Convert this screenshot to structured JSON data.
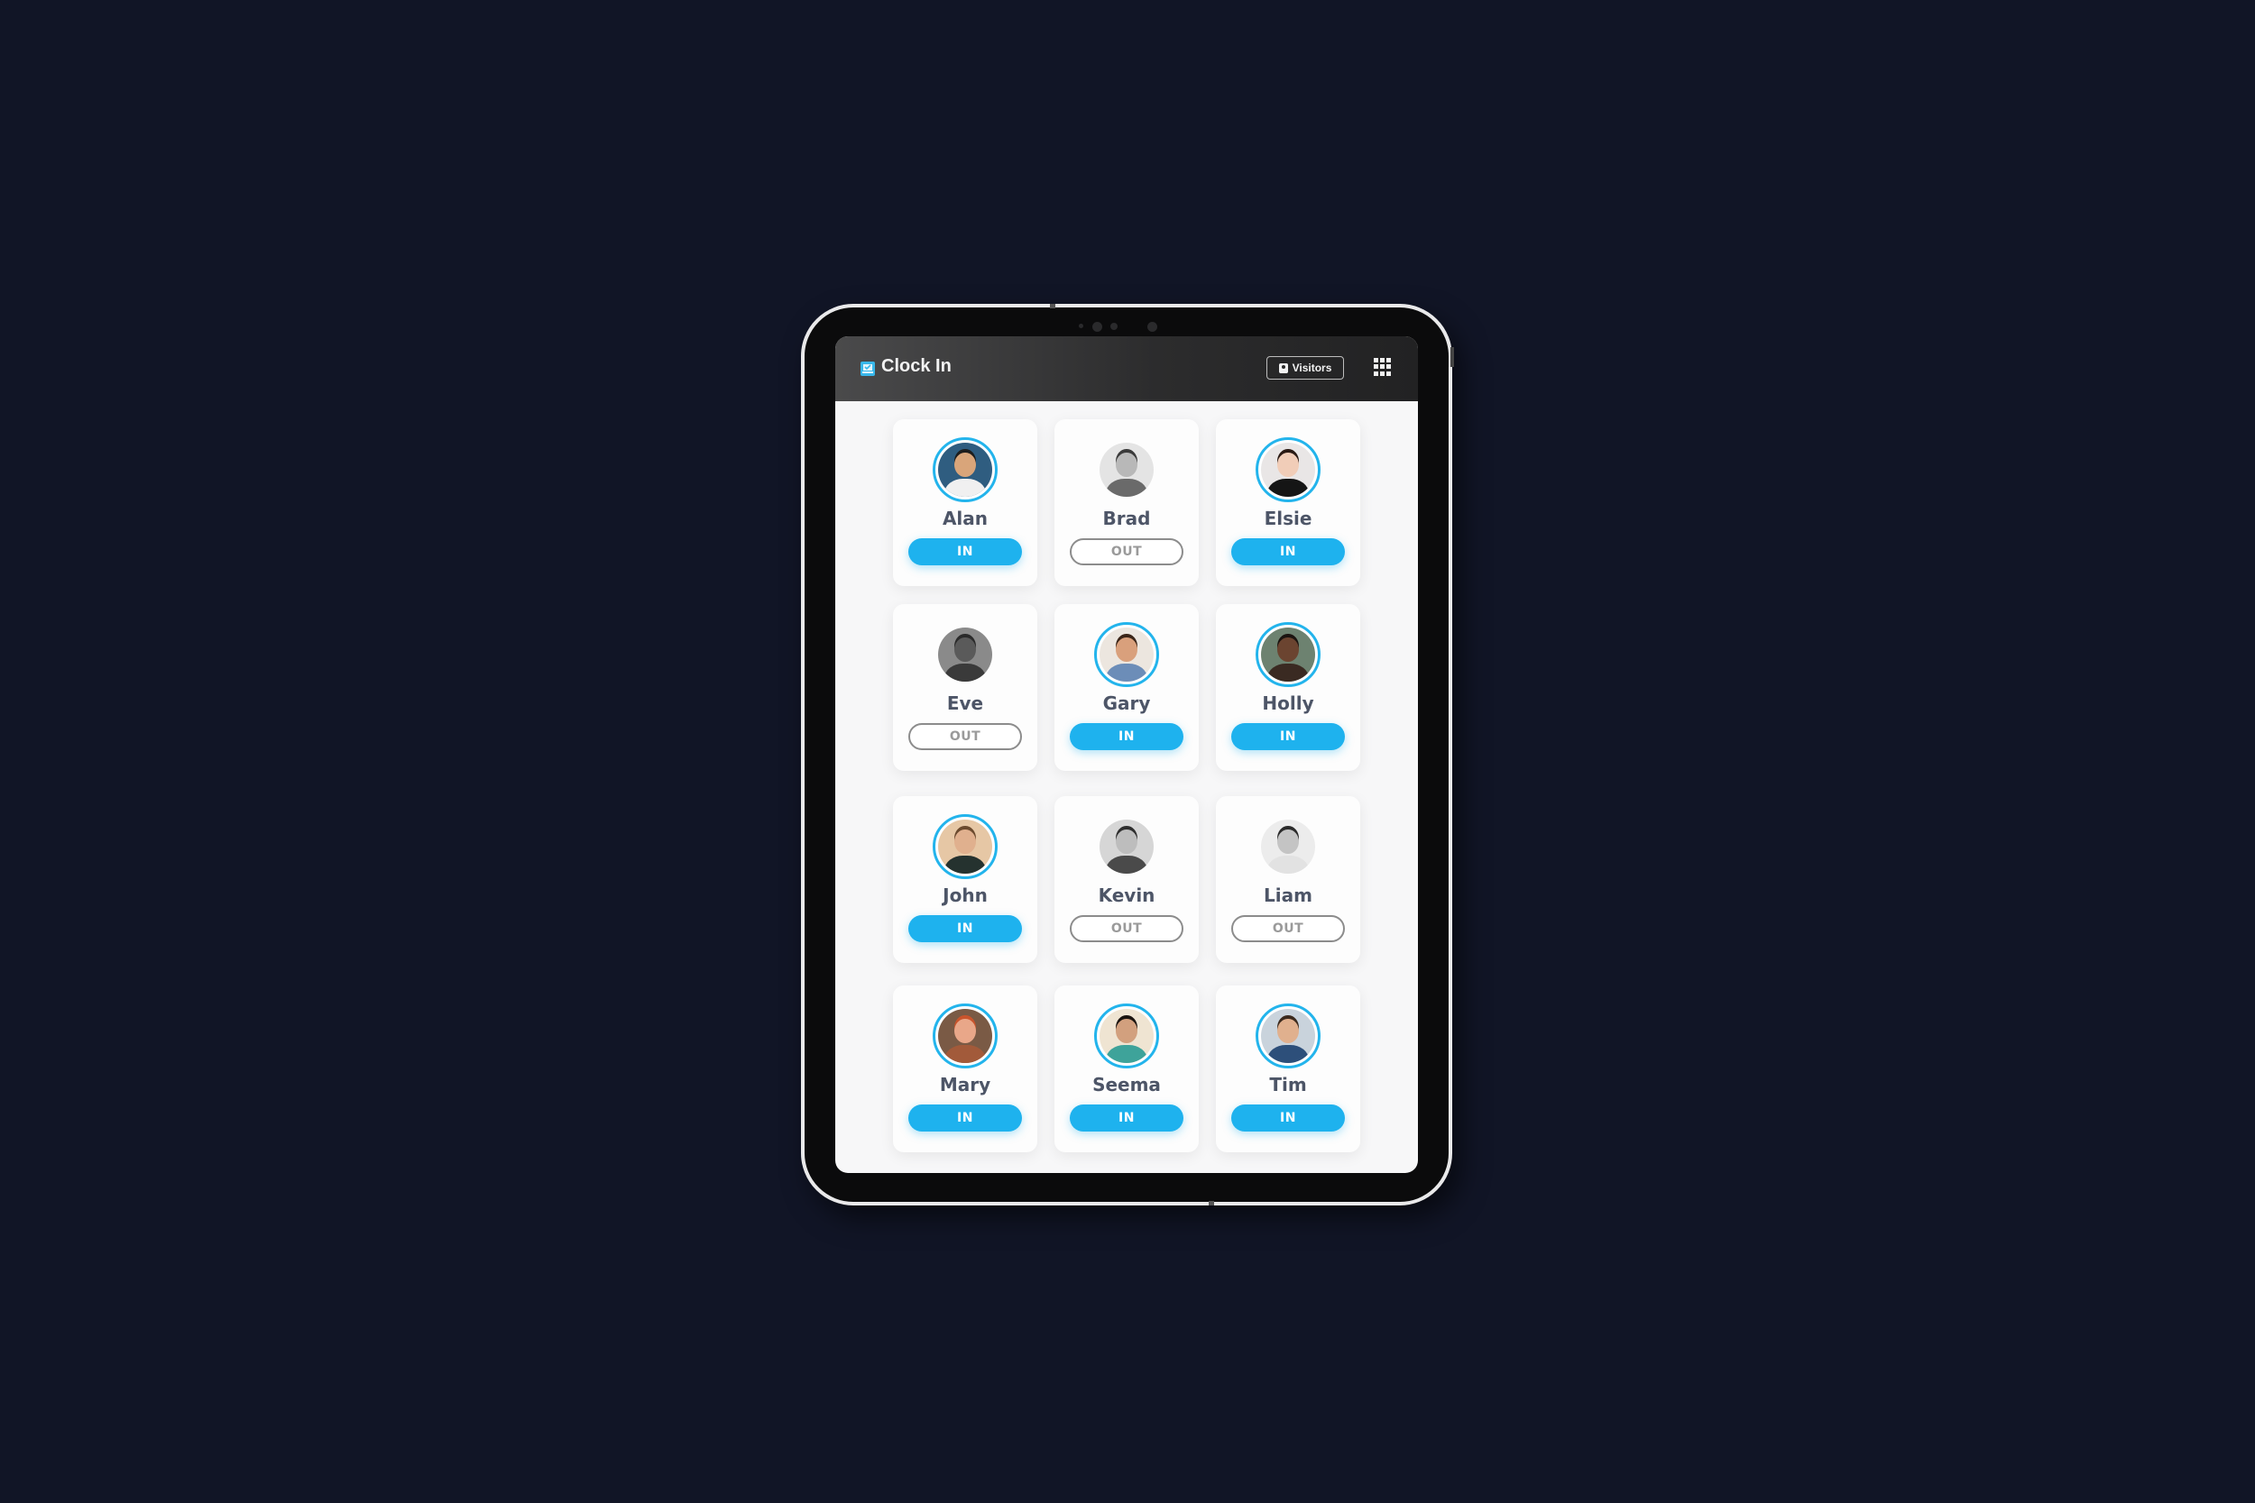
{
  "app": {
    "title": "Clock In",
    "logo_icon": "clipboard-check-icon",
    "accent_color": "#1eb2ee",
    "header": {
      "visitors_button": {
        "label": "Visitors",
        "icon": "id-badge-icon"
      },
      "apps_menu_icon": "grid-menu-icon"
    }
  },
  "employees": [
    {
      "name": "Alan",
      "status": "IN",
      "avatar": {
        "skin": "#d9a57a",
        "hair": "#1d1d1d",
        "bg": "#2f5d80",
        "shirt": "#f0f0f0",
        "grayscale": false
      }
    },
    {
      "name": "Brad",
      "status": "OUT",
      "avatar": {
        "skin": "#b8b8b8",
        "hair": "#3a3a3a",
        "bg": "#e4e4e4",
        "shirt": "#6a6a6a",
        "grayscale": true
      }
    },
    {
      "name": "Elsie",
      "status": "IN",
      "avatar": {
        "skin": "#f1cdb8",
        "hair": "#2a1a14",
        "bg": "#e9e6e6",
        "shirt": "#151515",
        "grayscale": false
      }
    },
    {
      "name": "Eve",
      "status": "OUT",
      "avatar": {
        "skin": "#5a5a5a",
        "hair": "#2a2a2a",
        "bg": "#8a8a8a",
        "shirt": "#3a3a3a",
        "grayscale": true
      }
    },
    {
      "name": "Gary",
      "status": "IN",
      "avatar": {
        "skin": "#d9a07c",
        "hair": "#3b2518",
        "bg": "#ece6df",
        "shirt": "#6c8db8",
        "grayscale": false
      }
    },
    {
      "name": "Holly",
      "status": "IN",
      "avatar": {
        "skin": "#6b4430",
        "hair": "#1b1410",
        "bg": "#6d8270",
        "shirt": "#3a2a22",
        "grayscale": false
      }
    },
    {
      "name": "John",
      "status": "IN",
      "avatar": {
        "skin": "#e0b08e",
        "hair": "#6b4a2e",
        "bg": "#e6c7a5",
        "shirt": "#25322f",
        "grayscale": false
      }
    },
    {
      "name": "Kevin",
      "status": "OUT",
      "avatar": {
        "skin": "#bdbdbd",
        "hair": "#2e2e2e",
        "bg": "#d6d6d6",
        "shirt": "#4a4a4a",
        "grayscale": true
      }
    },
    {
      "name": "Liam",
      "status": "OUT",
      "avatar": {
        "skin": "#c4c4c4",
        "hair": "#2b2b2b",
        "bg": "#ececec",
        "shirt": "#e2e2e2",
        "grayscale": true
      }
    },
    {
      "name": "Mary",
      "status": "IN",
      "avatar": {
        "skin": "#e9a789",
        "hair": "#c9542c",
        "bg": "#7a5a45",
        "shirt": "#a25a3a",
        "grayscale": false
      }
    },
    {
      "name": "Seema",
      "status": "IN",
      "avatar": {
        "skin": "#d2a07e",
        "hair": "#1b1410",
        "bg": "#efe4d2",
        "shirt": "#3ea39a",
        "grayscale": false
      }
    },
    {
      "name": "Tim",
      "status": "IN",
      "avatar": {
        "skin": "#e0b08e",
        "hair": "#3b2a1e",
        "bg": "#c9d3dc",
        "shirt": "#2d4f7a",
        "grayscale": false
      }
    }
  ]
}
